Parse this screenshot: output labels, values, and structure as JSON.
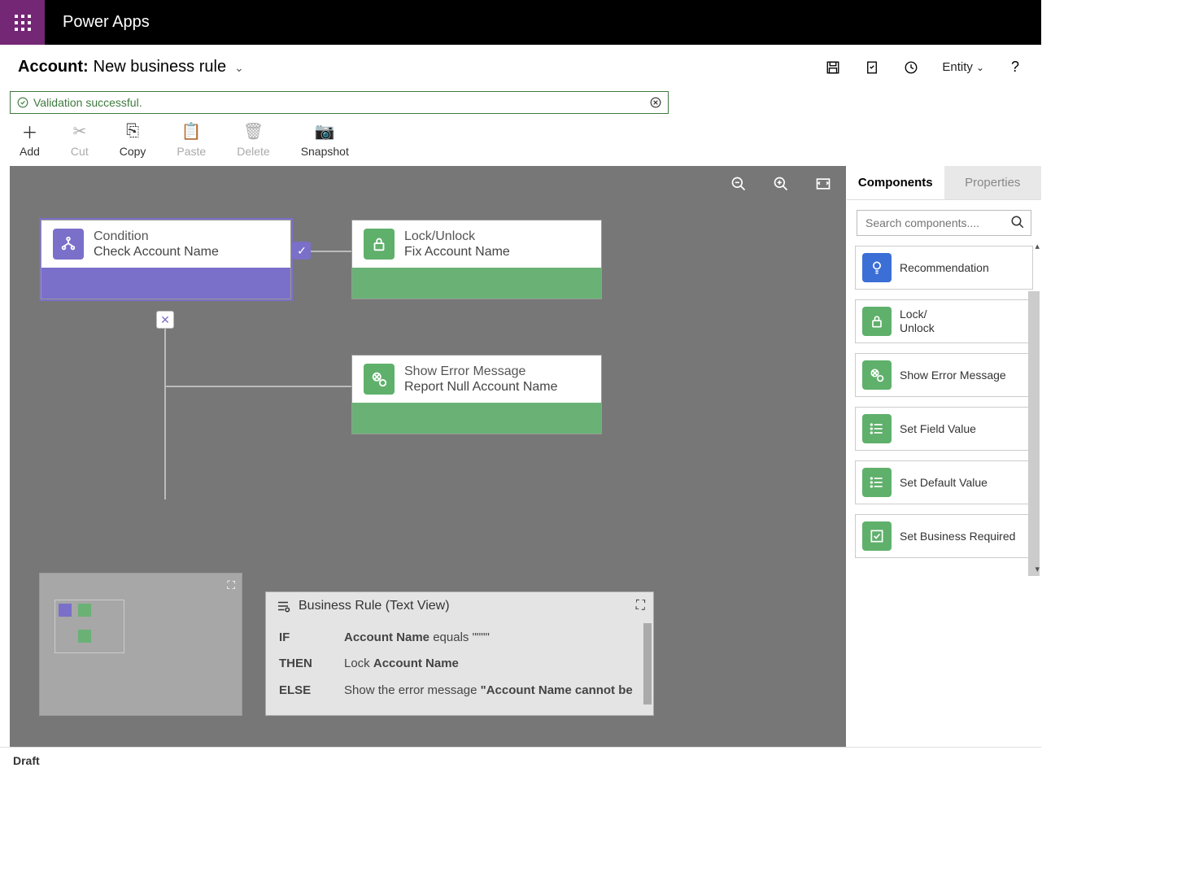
{
  "app_name": "Power Apps",
  "rule": {
    "entity": "Account",
    "name": "New business rule"
  },
  "validation": {
    "message": "Validation successful."
  },
  "header_actions": {
    "scope_label": "Entity"
  },
  "actions": {
    "add": "Add",
    "cut": "Cut",
    "copy": "Copy",
    "paste": "Paste",
    "delete": "Delete",
    "snapshot": "Snapshot"
  },
  "canvas": {
    "condition": {
      "title": "Condition",
      "subtitle": "Check Account Name"
    },
    "lock": {
      "title": "Lock/Unlock",
      "subtitle": "Fix Account Name"
    },
    "error": {
      "title": "Show Error Message",
      "subtitle": "Report Null Account Name"
    }
  },
  "textview": {
    "title": "Business Rule (Text View)",
    "if": "IF",
    "then": "THEN",
    "else": "ELSE",
    "if_val_pre": "Account Name",
    "if_val_post": " equals \"\"\"\"",
    "then_pre": "Lock ",
    "then_bold": "Account Name",
    "else_pre": "Show the error message ",
    "else_bold": "\"Account Name cannot be"
  },
  "sidebar": {
    "tab_components": "Components",
    "tab_properties": "Properties",
    "search_placeholder": "Search components....",
    "items": [
      {
        "label": "Recommendation",
        "color": "blue",
        "icon": "bulb"
      },
      {
        "label": "Lock/\nUnlock",
        "color": "green",
        "icon": "lock"
      },
      {
        "label": "Show Error Message",
        "color": "green",
        "icon": "error"
      },
      {
        "label": "Set Field Value",
        "color": "green",
        "icon": "list"
      },
      {
        "label": "Set Default Value",
        "color": "green",
        "icon": "list"
      },
      {
        "label": "Set Business Required",
        "color": "green",
        "icon": "check"
      }
    ]
  },
  "status": "Draft"
}
